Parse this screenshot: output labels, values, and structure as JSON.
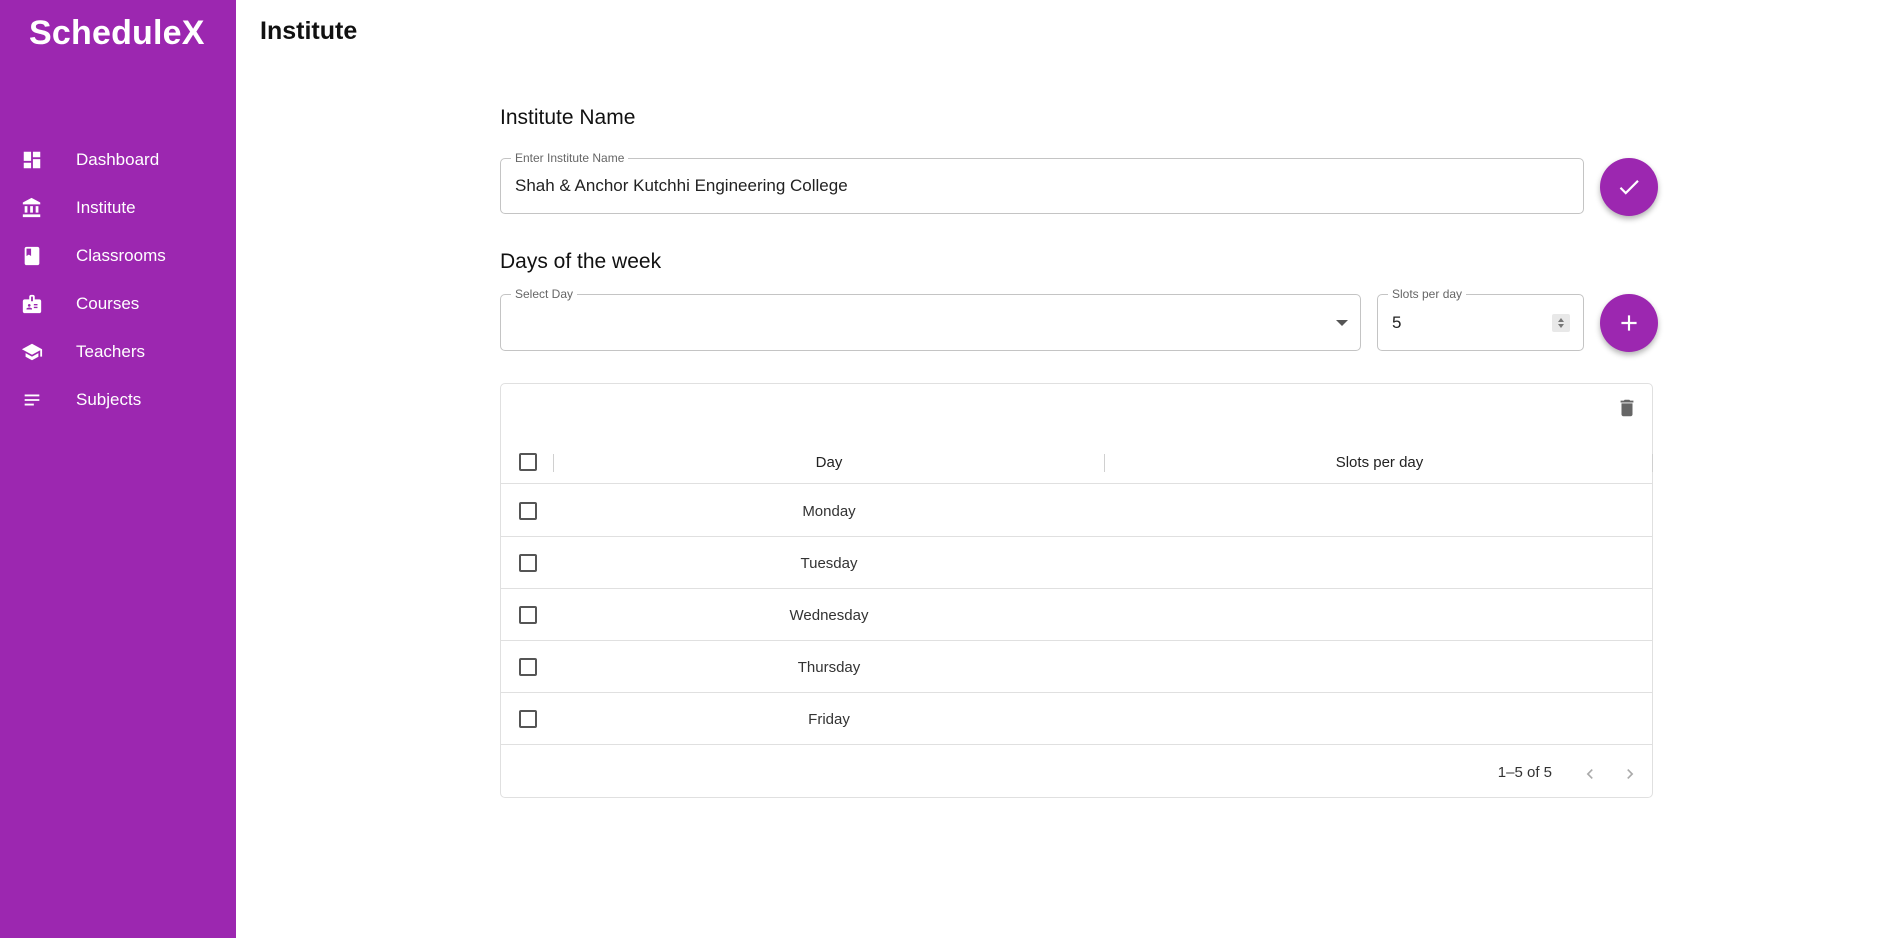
{
  "app": {
    "logo": "ScheduleX"
  },
  "sidebar": {
    "items": [
      {
        "label": "Dashboard",
        "icon": "dashboard-icon"
      },
      {
        "label": "Institute",
        "icon": "institute-icon"
      },
      {
        "label": "Classrooms",
        "icon": "book-icon"
      },
      {
        "label": "Courses",
        "icon": "badge-icon"
      },
      {
        "label": "Teachers",
        "icon": "school-icon"
      },
      {
        "label": "Subjects",
        "icon": "list-icon"
      }
    ]
  },
  "header": {
    "title": "Institute"
  },
  "institute": {
    "section_title": "Institute Name",
    "field_label": "Enter Institute Name",
    "field_value": "Shah & Anchor Kutchhi Engineering College",
    "confirm_icon": "check-icon"
  },
  "days": {
    "section_title": "Days of the week",
    "select_label": "Select Day",
    "select_value": "",
    "slots_label": "Slots per day",
    "slots_value": "5",
    "add_icon": "plus-icon"
  },
  "table": {
    "delete_icon": "trash-icon",
    "columns": [
      "Day",
      "Slots per day"
    ],
    "rows": [
      {
        "day": "Monday",
        "slots": ""
      },
      {
        "day": "Tuesday",
        "slots": ""
      },
      {
        "day": "Wednesday",
        "slots": ""
      },
      {
        "day": "Thursday",
        "slots": ""
      },
      {
        "day": "Friday",
        "slots": ""
      }
    ],
    "pagination": "1–5 of 5"
  },
  "colors": {
    "accent": "#9c27b0"
  }
}
